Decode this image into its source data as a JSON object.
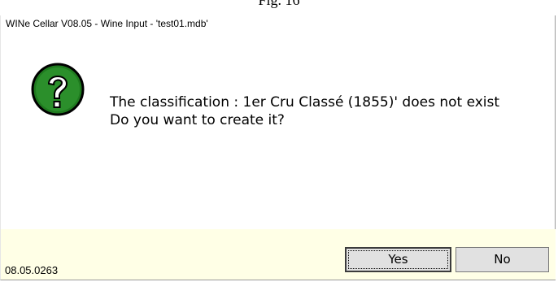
{
  "caption": "Fig. 16",
  "window": {
    "title": "WINe Cellar V08.05  - Wine Input -  'test01.mdb'"
  },
  "dialog": {
    "icon": "question-icon",
    "message_line1": "The classification : 1er Cru Classé (1855)' does not exist",
    "message_line2": "Do you want to create it?"
  },
  "footer": {
    "version": "08.05.0263",
    "yes_label": "Yes",
    "no_label": "No"
  },
  "colors": {
    "icon_green": "#1f7a1f",
    "footer_bg": "#ffffe6",
    "button_bg": "#e1e1e1"
  }
}
